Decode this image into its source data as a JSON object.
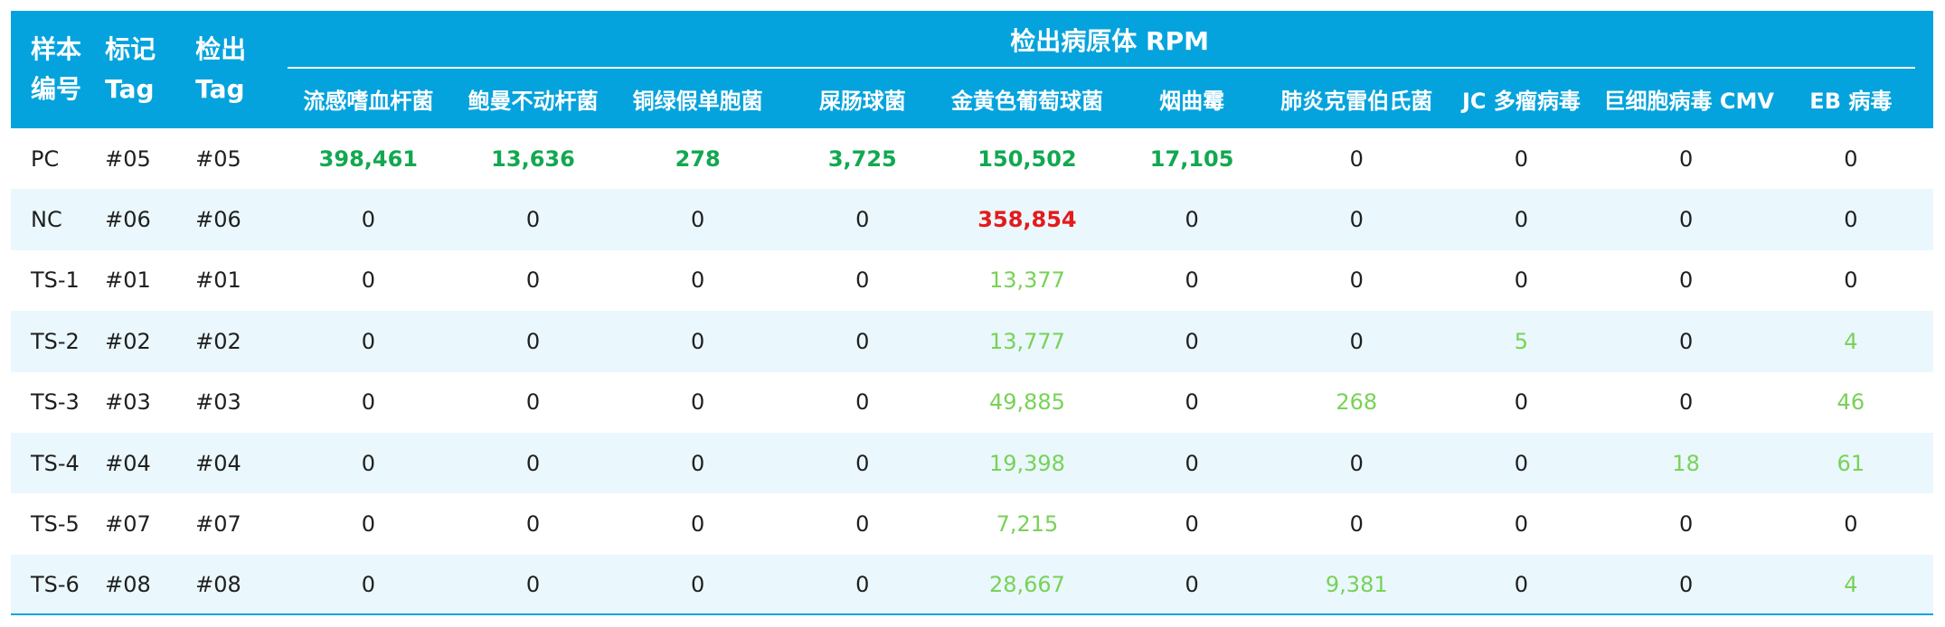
{
  "table": {
    "group_header": "检出病原体 RPM",
    "left_headers": [
      {
        "line1": "样本",
        "line2": "编号"
      },
      {
        "line1": "标记",
        "line2": "Tag"
      },
      {
        "line1": "检出",
        "line2": "Tag"
      }
    ],
    "pathogens": [
      "流感嗜血杆菌",
      "鲍曼不动杆菌",
      "铜绿假单胞菌",
      "屎肠球菌",
      "金黄色葡萄球菌",
      "烟曲霉",
      "肺炎克雷伯氏菌",
      "JC 多瘤病毒",
      "巨细胞病毒 CMV",
      "EB 病毒"
    ],
    "rows": [
      {
        "sample": "PC",
        "tag_marked": "#05",
        "tag_detected": "#05",
        "values": [
          {
            "v": "398,461",
            "s": "strong"
          },
          {
            "v": "13,636",
            "s": "strong"
          },
          {
            "v": "278",
            "s": "strong"
          },
          {
            "v": "3,725",
            "s": "strong"
          },
          {
            "v": "150,502",
            "s": "strong"
          },
          {
            "v": "17,105",
            "s": "strong"
          },
          {
            "v": "0",
            "s": ""
          },
          {
            "v": "0",
            "s": ""
          },
          {
            "v": "0",
            "s": ""
          },
          {
            "v": "0",
            "s": ""
          }
        ]
      },
      {
        "sample": "NC",
        "tag_marked": "#06",
        "tag_detected": "#06",
        "values": [
          {
            "v": "0",
            "s": ""
          },
          {
            "v": "0",
            "s": ""
          },
          {
            "v": "0",
            "s": ""
          },
          {
            "v": "0",
            "s": ""
          },
          {
            "v": "358,854",
            "s": "red"
          },
          {
            "v": "0",
            "s": ""
          },
          {
            "v": "0",
            "s": ""
          },
          {
            "v": "0",
            "s": ""
          },
          {
            "v": "0",
            "s": ""
          },
          {
            "v": "0",
            "s": ""
          }
        ]
      },
      {
        "sample": "TS-1",
        "tag_marked": "#01",
        "tag_detected": "#01",
        "values": [
          {
            "v": "0",
            "s": ""
          },
          {
            "v": "0",
            "s": ""
          },
          {
            "v": "0",
            "s": ""
          },
          {
            "v": "0",
            "s": ""
          },
          {
            "v": "13,377",
            "s": "light"
          },
          {
            "v": "0",
            "s": ""
          },
          {
            "v": "0",
            "s": ""
          },
          {
            "v": "0",
            "s": ""
          },
          {
            "v": "0",
            "s": ""
          },
          {
            "v": "0",
            "s": ""
          }
        ]
      },
      {
        "sample": "TS-2",
        "tag_marked": "#02",
        "tag_detected": "#02",
        "values": [
          {
            "v": "0",
            "s": ""
          },
          {
            "v": "0",
            "s": ""
          },
          {
            "v": "0",
            "s": ""
          },
          {
            "v": "0",
            "s": ""
          },
          {
            "v": "13,777",
            "s": "light"
          },
          {
            "v": "0",
            "s": ""
          },
          {
            "v": "0",
            "s": ""
          },
          {
            "v": "5",
            "s": "light"
          },
          {
            "v": "0",
            "s": ""
          },
          {
            "v": "4",
            "s": "light"
          }
        ]
      },
      {
        "sample": "TS-3",
        "tag_marked": "#03",
        "tag_detected": "#03",
        "values": [
          {
            "v": "0",
            "s": ""
          },
          {
            "v": "0",
            "s": ""
          },
          {
            "v": "0",
            "s": ""
          },
          {
            "v": "0",
            "s": ""
          },
          {
            "v": "49,885",
            "s": "light"
          },
          {
            "v": "0",
            "s": ""
          },
          {
            "v": "268",
            "s": "light"
          },
          {
            "v": "0",
            "s": ""
          },
          {
            "v": "0",
            "s": ""
          },
          {
            "v": "46",
            "s": "light"
          }
        ]
      },
      {
        "sample": "TS-4",
        "tag_marked": "#04",
        "tag_detected": "#04",
        "values": [
          {
            "v": "0",
            "s": ""
          },
          {
            "v": "0",
            "s": ""
          },
          {
            "v": "0",
            "s": ""
          },
          {
            "v": "0",
            "s": ""
          },
          {
            "v": "19,398",
            "s": "light"
          },
          {
            "v": "0",
            "s": ""
          },
          {
            "v": "0",
            "s": ""
          },
          {
            "v": "0",
            "s": ""
          },
          {
            "v": "18",
            "s": "light"
          },
          {
            "v": "61",
            "s": "light"
          }
        ]
      },
      {
        "sample": "TS-5",
        "tag_marked": "#07",
        "tag_detected": "#07",
        "values": [
          {
            "v": "0",
            "s": ""
          },
          {
            "v": "0",
            "s": ""
          },
          {
            "v": "0",
            "s": ""
          },
          {
            "v": "0",
            "s": ""
          },
          {
            "v": "7,215",
            "s": "light"
          },
          {
            "v": "0",
            "s": ""
          },
          {
            "v": "0",
            "s": ""
          },
          {
            "v": "0",
            "s": ""
          },
          {
            "v": "0",
            "s": ""
          },
          {
            "v": "0",
            "s": ""
          }
        ]
      },
      {
        "sample": "TS-6",
        "tag_marked": "#08",
        "tag_detected": "#08",
        "values": [
          {
            "v": "0",
            "s": ""
          },
          {
            "v": "0",
            "s": ""
          },
          {
            "v": "0",
            "s": ""
          },
          {
            "v": "0",
            "s": ""
          },
          {
            "v": "28,667",
            "s": "light"
          },
          {
            "v": "0",
            "s": ""
          },
          {
            "v": "9,381",
            "s": "light"
          },
          {
            "v": "0",
            "s": ""
          },
          {
            "v": "0",
            "s": ""
          },
          {
            "v": "4",
            "s": "light"
          }
        ]
      }
    ]
  },
  "colors": {
    "header_bg": "#05a3dd",
    "stripe_bg": "#eaf7fc",
    "strong_green": "#12a850",
    "light_green": "#78d257",
    "alert_red": "#e31b1b"
  }
}
